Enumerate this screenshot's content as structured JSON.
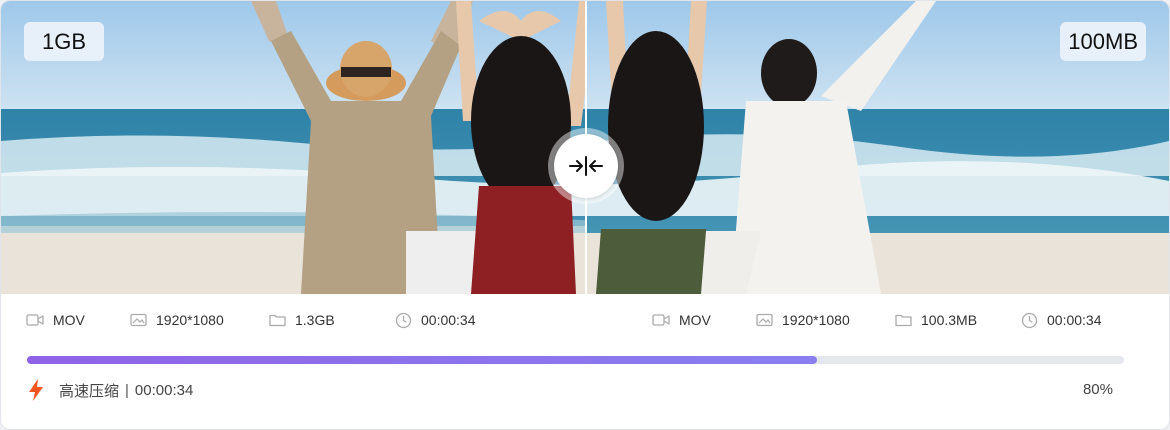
{
  "compare": {
    "original_size": "1GB",
    "compressed_size": "100MB"
  },
  "original": {
    "format": "MOV",
    "resolution": "1920*1080",
    "file_size": "1.3GB",
    "duration": "00:00:34"
  },
  "compressed": {
    "format": "MOV",
    "resolution": "1920*1080",
    "file_size": "100.3MB",
    "duration": "00:00:34"
  },
  "progress": {
    "fraction": 0.72,
    "mode_label": "高速压缩",
    "separator": "|",
    "elapsed": "00:00:34",
    "percent_text": "80%"
  },
  "icons": {
    "format": "video-camera-icon",
    "resolution": "image-icon",
    "file_size": "folder-icon",
    "duration": "clock-icon",
    "mode": "lightning-icon",
    "handle": "compare-arrows-icon"
  },
  "colors": {
    "progress_fill": "#8f63e6",
    "progress_track": "#e5e7ee",
    "lightning": "#f5561d"
  }
}
